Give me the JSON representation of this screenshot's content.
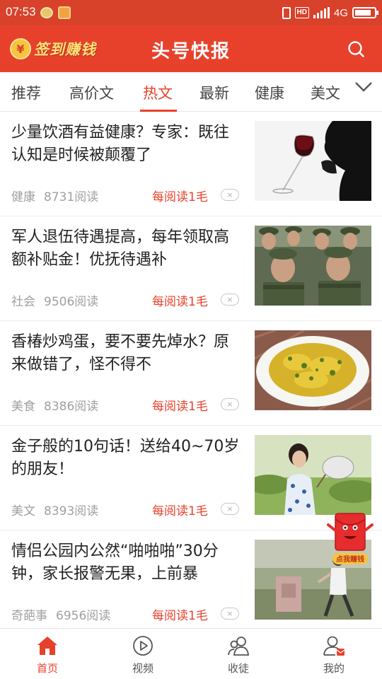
{
  "status_bar": {
    "time": "07:53",
    "network": "4G",
    "hd": "HD",
    "battery_level": 0.85
  },
  "header": {
    "checkin_label": "签到赚钱",
    "coin_symbol": "¥",
    "app_title": "头号快报"
  },
  "tabs": [
    {
      "label": "推荐"
    },
    {
      "label": "高价文"
    },
    {
      "label": "热文",
      "active": true
    },
    {
      "label": "最新"
    },
    {
      "label": "健康"
    },
    {
      "label": "美文"
    }
  ],
  "feed": [
    {
      "title": "少量饮酒有益健康？专家：既往认知是时候被颠覆了",
      "category": "健康",
      "reads": "8731阅读",
      "reward": "每阅读1毛",
      "dismiss": "×"
    },
    {
      "title": "军人退伍待遇提高，每年领取高额补贴金！优抚待遇补",
      "category": "社会",
      "reads": "9506阅读",
      "reward": "每阅读1毛",
      "dismiss": "×"
    },
    {
      "title": "香椿炒鸡蛋，要不要先焯水？原来做错了，怪不得不",
      "category": "美食",
      "reads": "8386阅读",
      "reward": "每阅读1毛",
      "dismiss": "×"
    },
    {
      "title": "金子般的10句话！送给40~70岁的朋友！",
      "category": "美文",
      "reads": "8393阅读",
      "reward": "每阅读1毛",
      "dismiss": "×"
    },
    {
      "title": "情侣公园内公然“啪啪啪”30分钟，家长报警无果，上前暴",
      "category": "奇葩事",
      "reads": "6956阅读",
      "reward": "每阅读1毛",
      "dismiss": "×"
    }
  ],
  "floating_envelope": {
    "label": "点我赚钱"
  },
  "bottom_nav": [
    {
      "label": "首页",
      "icon": "home-icon",
      "active": true
    },
    {
      "label": "视频",
      "icon": "play-icon"
    },
    {
      "label": "收徒",
      "icon": "people-icon"
    },
    {
      "label": "我的",
      "icon": "profile-icon"
    }
  ],
  "colors": {
    "brand": "#e8412b",
    "status_bar": "#d8412a",
    "text": "#222222",
    "meta": "#a0a0a0"
  }
}
